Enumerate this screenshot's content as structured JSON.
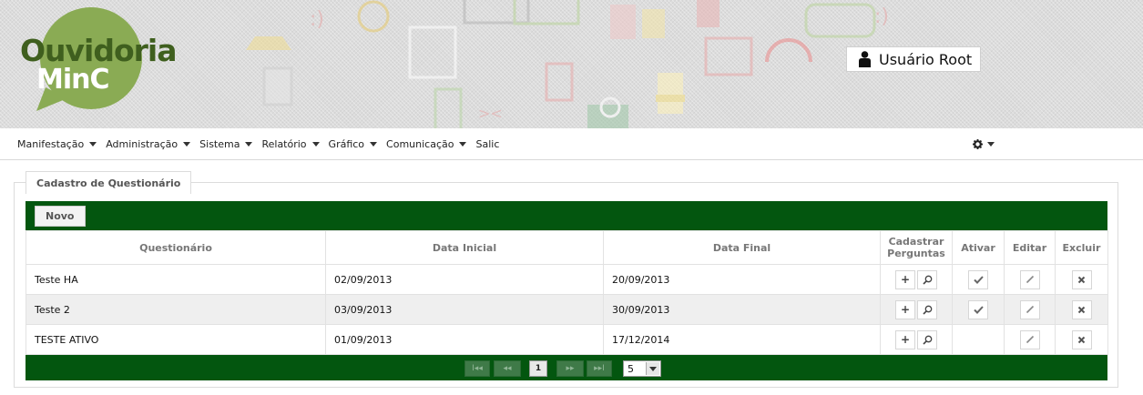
{
  "header": {
    "logo_line1": "Ouvidoria",
    "logo_line2": "MinC",
    "user_label": "Usuário Root"
  },
  "colors": {
    "brand_green": "#03560f",
    "logo_green": "#8aab54",
    "logo_dark": "#3f5f1e"
  },
  "menu": {
    "items": [
      {
        "label": "Manifestação",
        "has_dropdown": true
      },
      {
        "label": "Administração",
        "has_dropdown": true
      },
      {
        "label": "Sistema",
        "has_dropdown": true
      },
      {
        "label": "Relatório",
        "has_dropdown": true
      },
      {
        "label": "Gráfico",
        "has_dropdown": true
      },
      {
        "label": "Comunicação",
        "has_dropdown": true
      },
      {
        "label": "Salic",
        "has_dropdown": false
      }
    ],
    "settings_icon": "gear-icon"
  },
  "panel": {
    "title": "Cadastro de Questionário",
    "new_button": "Novo"
  },
  "table": {
    "headers": {
      "questionario": "Questionário",
      "data_inicial": "Data Inicial",
      "data_final": "Data Final",
      "cadastrar_1": "Cadastrar",
      "cadastrar_2": "Perguntas",
      "ativar": "Ativar",
      "editar": "Editar",
      "excluir": "Excluir"
    },
    "rows": [
      {
        "name": "Teste HA",
        "start": "02/09/2013",
        "end": "20/09/2013",
        "can_activate": true
      },
      {
        "name": "Teste 2",
        "start": "03/09/2013",
        "end": "30/09/2013",
        "can_activate": true
      },
      {
        "name": "TESTE ATIVO",
        "start": "01/09/2013",
        "end": "17/12/2014",
        "can_activate": false
      }
    ]
  },
  "pager": {
    "first": "I◂◂",
    "prev": "◂◂",
    "current_page": "1",
    "next": "▸▸",
    "last": "▸▸I",
    "page_size": "5"
  }
}
